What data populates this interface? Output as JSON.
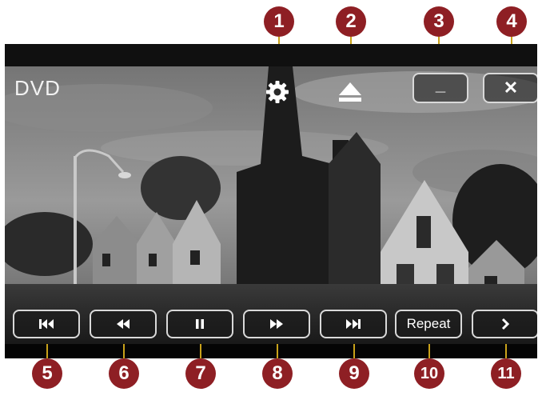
{
  "app": {
    "title": "DVD"
  },
  "top_controls": {
    "settings_icon": "gear-icon",
    "eject_icon": "eject-icon",
    "minimize_label": "_",
    "close_label": "✕"
  },
  "bottom_controls": {
    "previous_icon": "skip-previous-icon",
    "rewind_icon": "rewind-icon",
    "pause_icon": "pause-icon",
    "fast_forward_icon": "fast-forward-icon",
    "next_icon": "skip-next-icon",
    "repeat_label": "Repeat",
    "more_label": "›"
  },
  "callouts": [
    "1",
    "2",
    "3",
    "4",
    "5",
    "6",
    "7",
    "8",
    "9",
    "10",
    "11"
  ],
  "colors": {
    "callout_bg": "#8e1f24",
    "leader_line": "#c9a21a",
    "button_border": "#d9d9d9"
  }
}
